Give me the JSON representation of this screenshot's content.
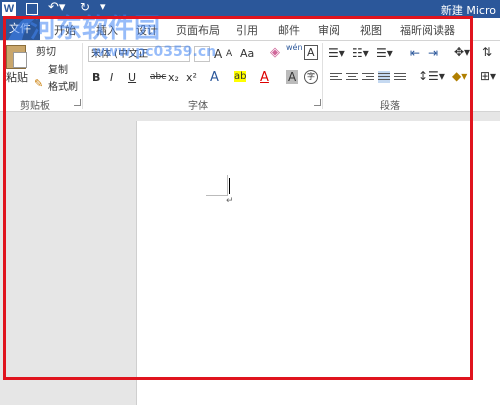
{
  "window": {
    "title": "新建 Micro",
    "logo_letter": "W"
  },
  "quick_access": {
    "save_icon": "save-icon",
    "undo_icon": "undo-icon",
    "redo_icon": "redo-icon",
    "more_icon": "customize-icon"
  },
  "tabs": {
    "file": "文件",
    "items": [
      "开始",
      "插入",
      "设计",
      "页面布局",
      "引用",
      "邮件",
      "审阅",
      "视图",
      "福昕阅读器"
    ]
  },
  "clipboard": {
    "paste": "粘贴",
    "cut": "剪切",
    "copy": "复制",
    "format_painter": "格式刷",
    "label": "剪贴板"
  },
  "font": {
    "family": "宋体 (中文正",
    "grow": "A",
    "shrink": "A",
    "case": "Aa",
    "clear": "A",
    "phonetic": "wén",
    "border_char": "A",
    "bold": "B",
    "italic": "I",
    "underline": "U",
    "strike": "abc",
    "subscript": "x₂",
    "superscript": "x²",
    "effects": "A",
    "highlight": "ab",
    "color": "A",
    "shading": "A",
    "enclose": "字",
    "label": "字体"
  },
  "paragraph": {
    "label": "段落"
  },
  "watermark": {
    "text": "河东软件园",
    "url": "www.pc0359.cn"
  },
  "colors": {
    "accent": "#2b579a",
    "annotation": "#e0141e"
  }
}
